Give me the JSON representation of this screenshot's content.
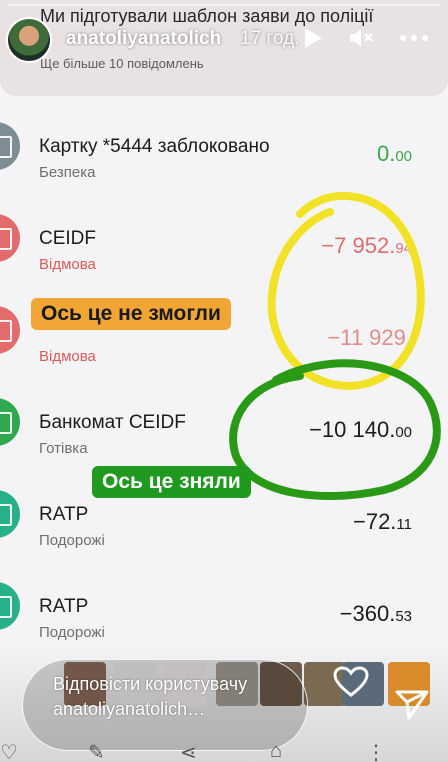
{
  "banner": {
    "title": "Ми підготували шаблон заяви до поліції",
    "subtitle": "Ще більше 10 повідомлень"
  },
  "story": {
    "username": "anatoliyanatolich",
    "time": "17 год."
  },
  "transactions": [
    {
      "name": "Картку *5444 заблоковано",
      "category": "Безпека",
      "amount_main": "0.",
      "amount_cents": "00",
      "icon_color": "#7d8c95"
    },
    {
      "name": "CEIDF",
      "category": "Відмова",
      "amount_main": "−7 952.",
      "amount_cents": "94",
      "icon_color": "#e26c6c"
    },
    {
      "name": "",
      "category": "Відмова",
      "amount_main": "−11 929.",
      "amount_cents": "",
      "icon_color": "#e26c6c"
    },
    {
      "name": "Банкомат CEIDF",
      "category": "Готівка",
      "amount_main": "−10 140.",
      "amount_cents": "00",
      "icon_color": "#2fa84f"
    },
    {
      "name": "RATP",
      "category": "Подорожі",
      "amount_main": "−72.",
      "amount_cents": "11",
      "icon_color": "#27b089"
    },
    {
      "name": "RATP",
      "category": "Подорожі",
      "amount_main": "−360.",
      "amount_cents": "53",
      "icon_color": "#27b089"
    }
  ],
  "annotations": {
    "failed": "Ось це не змогли",
    "withdrawn": "Ось це зняли"
  },
  "reply": {
    "placeholder": "Відповісти користувачу anatoliyanatolich…"
  },
  "colors": {
    "annotation_yellow": "#f2e227",
    "annotation_green": "#1f9a1f",
    "annotation_orange": "#f1a535"
  }
}
